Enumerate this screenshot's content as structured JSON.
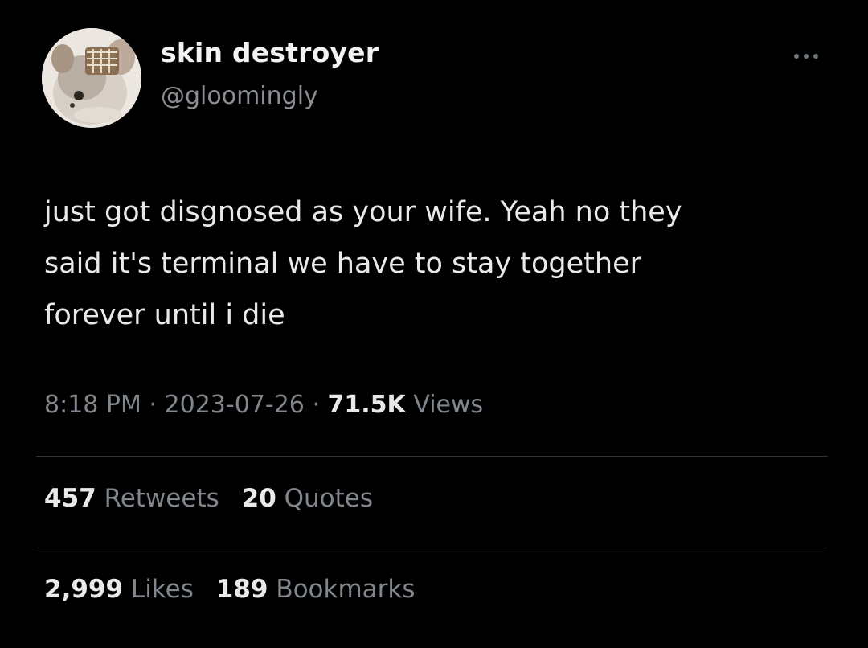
{
  "author": {
    "display_name": "skin destroyer",
    "handle": "@gloomingly",
    "avatar_icon": "profile-avatar"
  },
  "header": {
    "more_icon": "more-horizontal-icon"
  },
  "tweet": {
    "lines": [
      "just got disgnosed as your wife. Yeah no they",
      "said it's terminal we have to stay together",
      "forever until i die"
    ]
  },
  "meta": {
    "time": "8:18 PM",
    "separator": "·",
    "date": "2023-07-26",
    "views_count": "71.5K",
    "views_label": "Views"
  },
  "engagement": {
    "retweets_count": "457",
    "retweets_label": "Retweets",
    "quotes_count": "20",
    "quotes_label": "Quotes",
    "likes_count": "2,999",
    "likes_label": "Likes",
    "bookmarks_count": "189",
    "bookmarks_label": "Bookmarks"
  },
  "colors": {
    "background": "#000000",
    "primary_text": "#e7e9ea",
    "secondary_text": "#80868b",
    "divider": "#2f3336"
  }
}
